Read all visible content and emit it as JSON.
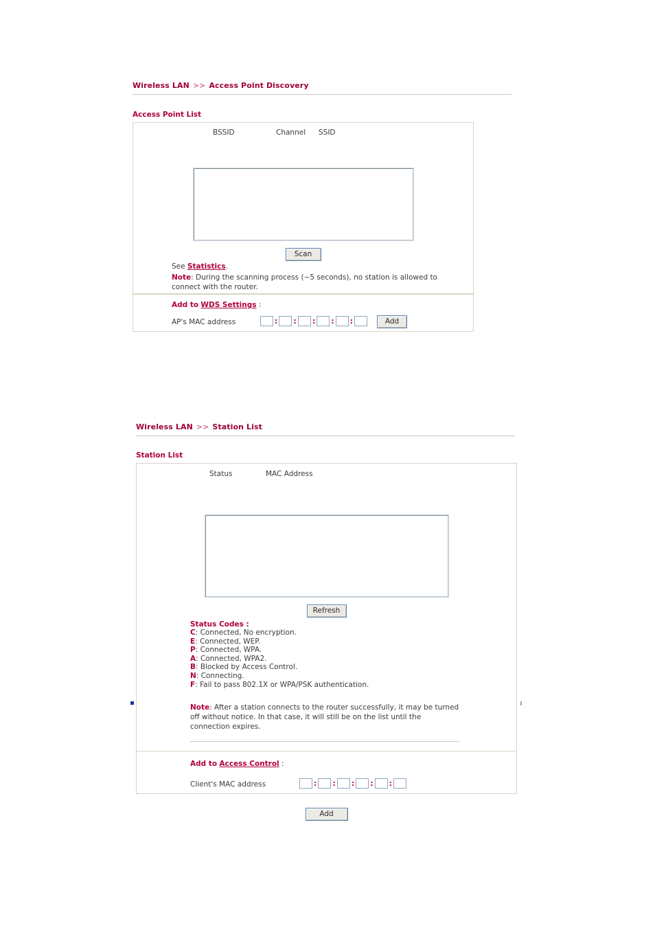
{
  "page": {
    "background": "#ffffff",
    "title_color": "#9e0039",
    "accent_color": "#b0003a",
    "panel_border_color": "#d8d4c4"
  },
  "access_point_discovery": {
    "breadcrumb": {
      "root": "Wireless LAN",
      "separator": ">>",
      "leaf": "Access Point Discovery"
    },
    "section_title": "Access Point List",
    "columns": [
      "BSSID",
      "Channel",
      "SSID"
    ],
    "rows": [],
    "scan_button": "Scan",
    "see_prefix": "See",
    "see_link": "Statistics",
    "see_suffix": ".",
    "note_label": "Note",
    "note_text": ": During the scanning process (~5 seconds), no station is allowed to connect with the router.",
    "add_to_lead": "Add to",
    "add_to_link": "WDS Settings",
    "add_to_colon": ":",
    "mac_label": "AP's MAC address",
    "mac_fields": [
      "",
      "",
      "",
      "",
      "",
      ""
    ],
    "mac_separator": ":",
    "add_button": "Add"
  },
  "station_list": {
    "breadcrumb": {
      "root": "Wireless LAN",
      "separator": ">>",
      "leaf": "Station List"
    },
    "section_title": "Station List",
    "columns": [
      "Status",
      "MAC Address"
    ],
    "rows": [],
    "refresh_button": "Refresh",
    "status_codes_title": "Status Codes :",
    "status_codes": [
      {
        "key": "C",
        "desc": ": Connected, No encryption."
      },
      {
        "key": "E",
        "desc": ": Connected, WEP."
      },
      {
        "key": "P",
        "desc": ": Connected, WPA."
      },
      {
        "key": "A",
        "desc": ": Connected, WPA2."
      },
      {
        "key": "B",
        "desc": ": Blocked by Access Control."
      },
      {
        "key": "N",
        "desc": ": Connecting."
      },
      {
        "key": "F",
        "desc": ": Fail to pass 802.1X or WPA/PSK authentication."
      }
    ],
    "note_label": "Note",
    "note_text": ": After a station connects to the router successfully, it may be turned off without notice. In that case, it will still be on the list until the connection expires.",
    "add_to_lead": "Add to",
    "add_to_link": "Access Control",
    "add_to_colon": ":",
    "mac_label": "Client's MAC address",
    "mac_fields": [
      "",
      "",
      "",
      "",
      "",
      ""
    ],
    "mac_separator": ":",
    "add_button": "Add"
  }
}
